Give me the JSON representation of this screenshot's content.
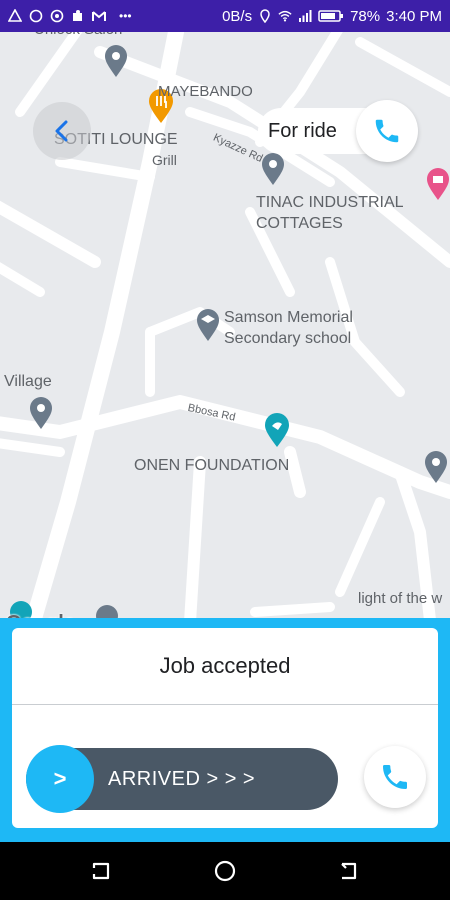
{
  "status_bar": {
    "net_speed": "0B/s",
    "battery": "78%",
    "time": "3:40 PM",
    "dots": "•••"
  },
  "map": {
    "labels": {
      "top_cut": "Unlock Salon",
      "mayebando": "MAYEBANDO",
      "sotiti": "SOTITI LOUNGE",
      "grill": "Grill",
      "kyazze": "Kyazze Rd",
      "tinac1": "TINAC INDUSTRIAL",
      "tinac2": "COTTAGES",
      "samson1": "Samson Memorial",
      "samson2": "Secondary school",
      "village": "Village",
      "bbosa": "Bbosa Rd",
      "onen": "ONEN FOUNDATION",
      "light": "light of the w"
    },
    "google_logo": "Google"
  },
  "ride": {
    "label": "For ride"
  },
  "job": {
    "status": "Job accepted",
    "slider_label": "ARRIVED  > > >",
    "knob": ">"
  },
  "colors": {
    "accent": "#1eb8f5",
    "status_bar": "#3d1fa8",
    "slider": "#4a5866"
  }
}
